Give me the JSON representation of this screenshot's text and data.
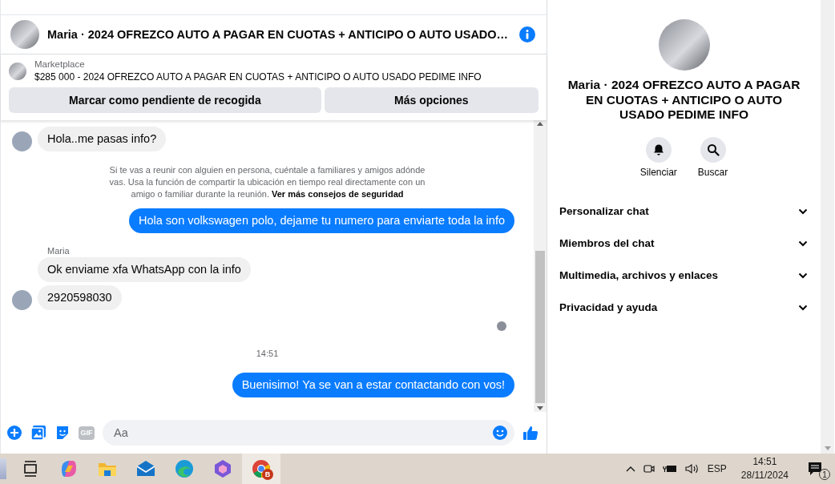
{
  "chat": {
    "title": "Maria · 2024 OFREZCO AUTO A PAGAR EN CUOTAS + ANTICIPO O AUTO USADO…",
    "listing": {
      "source": "Marketplace",
      "description": "$285 000 - 2024 OFREZCO AUTO A PAGAR EN CUOTAS + ANTICIPO O AUTO USADO PEDIME INFO"
    },
    "actions": [
      "Marcar como pendiente de recogida",
      "Más opciones"
    ],
    "messages": [
      {
        "kind": "incoming",
        "text": "Hola..me pasas info?",
        "avatar": true
      },
      {
        "kind": "notice",
        "text": "Si te vas a reunir con alguien en persona, cuéntale a familiares y amigos adónde vas. Usa la función de compartir la ubicación en tiempo real directamente con un amigo o familiar durante la reunión.",
        "link": "Ver más consejos de seguridad"
      },
      {
        "kind": "outgoing",
        "text": "Hola son volkswagen polo, dejame tu numero para enviarte toda la info"
      },
      {
        "kind": "sender",
        "text": "Maria"
      },
      {
        "kind": "incoming",
        "text": "Ok enviame xfa WhatsApp con la info",
        "avatar": false
      },
      {
        "kind": "incoming",
        "text": "2920598030",
        "avatar": true
      },
      {
        "kind": "seen"
      },
      {
        "kind": "timestamp",
        "text": "14:51"
      },
      {
        "kind": "outgoing",
        "text": "Buenisimo! Ya se van a estar contactando con vos!"
      }
    ],
    "composer": {
      "gif_label": "GIF",
      "placeholder": "Aa"
    }
  },
  "info_panel": {
    "title": "Maria · 2024 OFREZCO AUTO A PAGAR EN CUOTAS + ANTICIPO O AUTO USADO PEDIME INFO",
    "actions": [
      {
        "kind": "mute",
        "label": "Silenciar"
      },
      {
        "kind": "search",
        "label": "Buscar"
      }
    ],
    "sections": [
      {
        "label": "Personalizar chat",
        "expanded": false
      },
      {
        "label": "Miembros del chat",
        "expanded": false
      },
      {
        "label": "Multimedia, archivos y enlaces",
        "expanded": false
      },
      {
        "label": "Privacidad y ayuda",
        "expanded": false
      }
    ]
  },
  "taskbar": {
    "chrome_badge": "B",
    "language": "ESP",
    "time": "14:51",
    "date": "28/11/2024",
    "notification_count": "1"
  }
}
